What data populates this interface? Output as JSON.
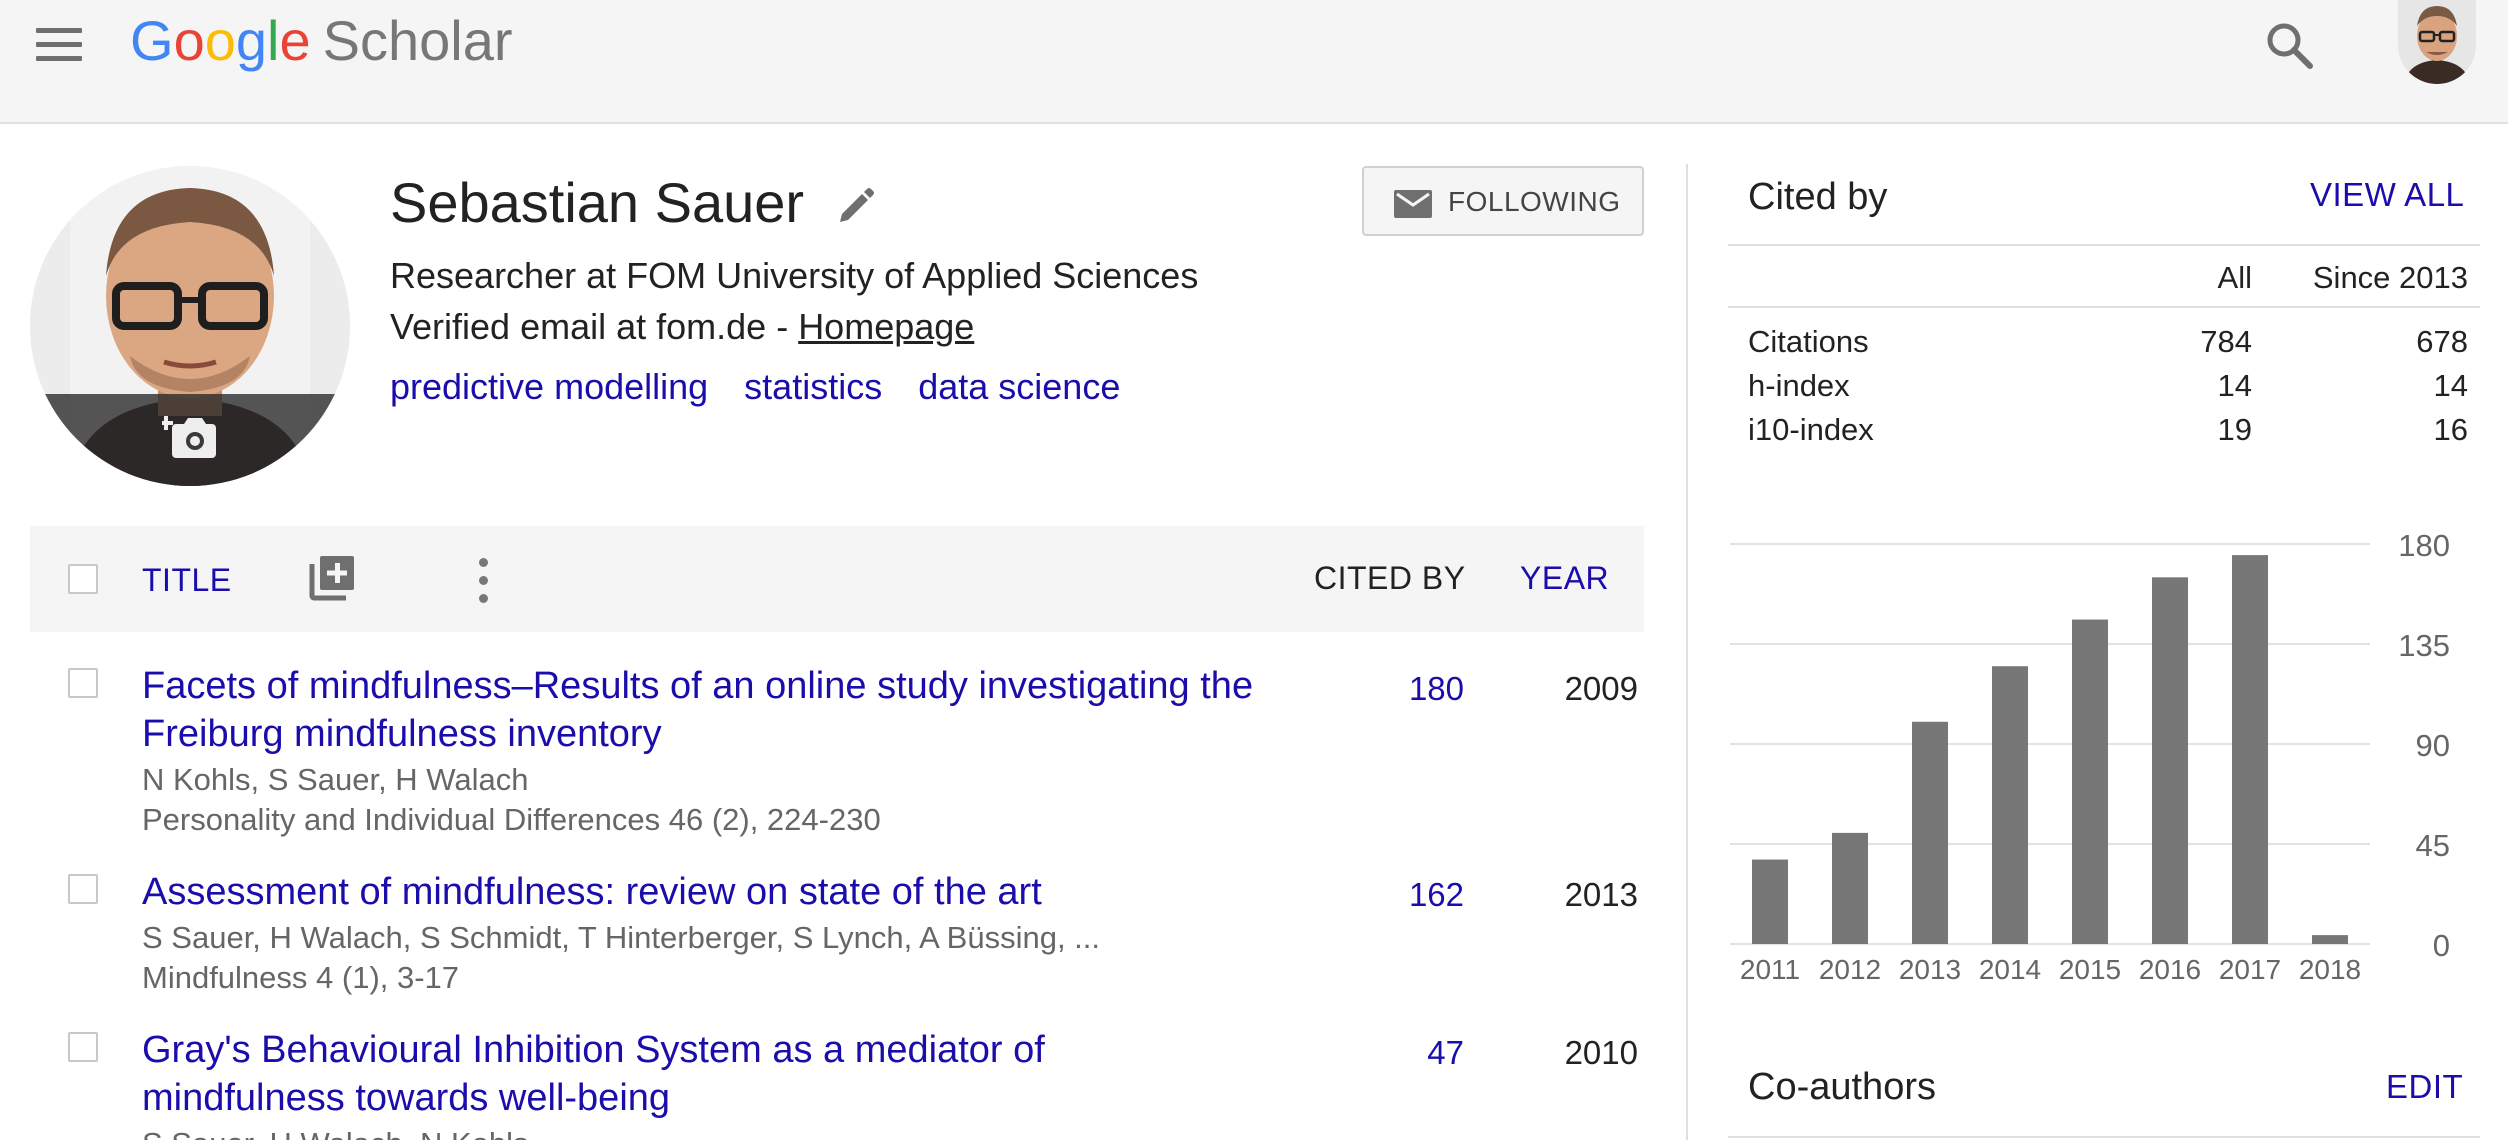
{
  "app": {
    "logo_google": "Google",
    "logo_product": "Scholar"
  },
  "profile": {
    "name": "Sebastian Sauer",
    "affiliation": "Researcher at FOM University of Applied Sciences",
    "email_text": "Verified email at fom.de - ",
    "homepage_label": "Homepage",
    "interests": [
      "predictive modelling",
      "statistics",
      "data science"
    ],
    "follow_label": "FOLLOWING"
  },
  "list_header": {
    "title_label": "TITLE",
    "cited_by_label": "CITED BY",
    "year_label": "YEAR"
  },
  "publications": [
    {
      "title": "Facets of mindfulness–Results of an online study investigating the Freiburg mindfulness inventory",
      "authors": "N Kohls, S Sauer, H Walach",
      "venue": "Personality and Individual Differences 46 (2), 224-230",
      "cited_by": "180",
      "year": "2009"
    },
    {
      "title": "Assessment of mindfulness: review on state of the art",
      "authors": "S Sauer, H Walach, S Schmidt, T Hinterberger, S Lynch, A Büssing, ...",
      "venue": "Mindfulness 4 (1), 3-17",
      "cited_by": "162",
      "year": "2013"
    },
    {
      "title": "Gray's Behavioural Inhibition System as a mediator of mindfulness towards well-being",
      "authors": "S Sauer, H Walach, N Kohls",
      "venue": "",
      "cited_by": "47",
      "year": "2010"
    }
  ],
  "cited_by": {
    "title": "Cited by",
    "view_all_label": "VIEW ALL",
    "col_all": "All",
    "col_since": "Since 2013",
    "rows": [
      {
        "label": "Citations",
        "all": "784",
        "since": "678"
      },
      {
        "label": "h-index",
        "all": "14",
        "since": "14"
      },
      {
        "label": "i10-index",
        "all": "19",
        "since": "16"
      }
    ]
  },
  "chart_data": {
    "type": "bar",
    "categories": [
      "2011",
      "2012",
      "2013",
      "2014",
      "2015",
      "2016",
      "2017",
      "2018"
    ],
    "values": [
      38,
      50,
      100,
      125,
      146,
      165,
      175,
      4
    ],
    "yticks": [
      "0",
      "45",
      "90",
      "135",
      "180"
    ],
    "ylim": [
      0,
      180
    ],
    "grid": true,
    "bar_color": "#777777"
  },
  "coauthors": {
    "title": "Co-authors",
    "edit_label": "EDIT"
  },
  "colors": {
    "link": "#1a0dab",
    "topbar_bg": "#f5f5f5"
  }
}
